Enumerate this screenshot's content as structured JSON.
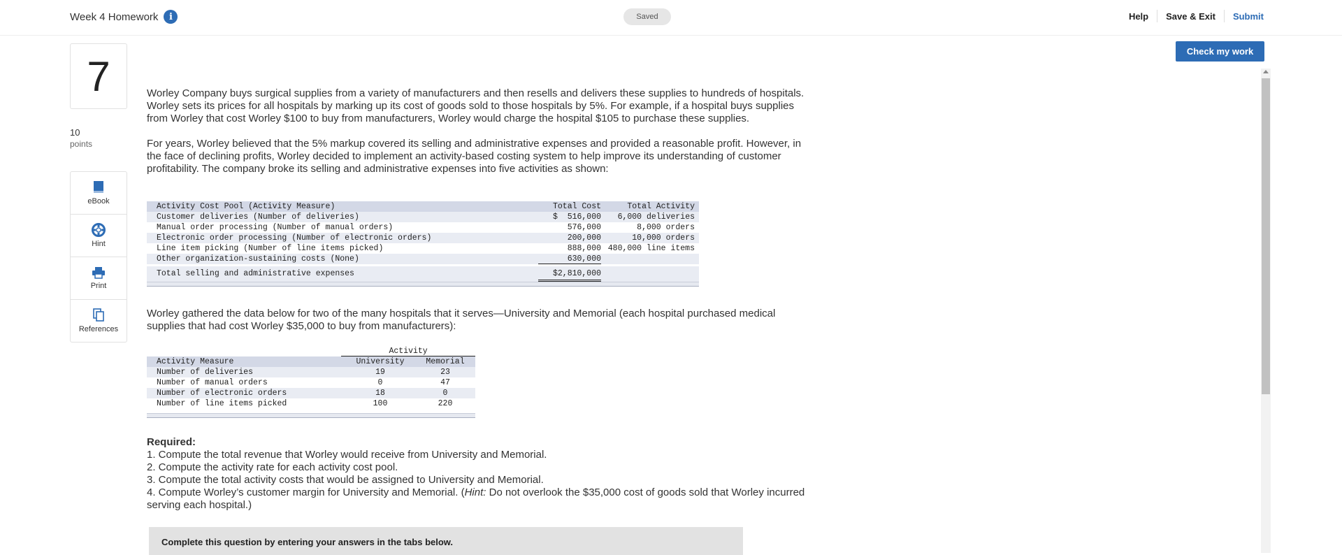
{
  "header": {
    "title": "Week 4 Homework",
    "status": "Saved",
    "help": "Help",
    "save_exit": "Save & Exit",
    "submit": "Submit"
  },
  "check_my_work": "Check my work",
  "question": {
    "number": "7",
    "points_value": "10",
    "points_label": "points"
  },
  "tools": [
    {
      "label": "eBook",
      "icon": "book-icon"
    },
    {
      "label": "Hint",
      "icon": "lifebuoy-icon"
    },
    {
      "label": "Print",
      "icon": "printer-icon"
    },
    {
      "label": "References",
      "icon": "copy-icon"
    }
  ],
  "paragraphs": {
    "p1": "Worley Company buys surgical supplies from a variety of manufacturers and then resells and delivers these supplies to hundreds of hospitals. Worley sets its prices for all hospitals by marking up its cost of goods sold to those hospitals by 5%. For example, if a hospital buys supplies from Worley that cost Worley $100 to buy from manufacturers, Worley would charge the hospital $105 to purchase these supplies.",
    "p2": "For years, Worley believed that the 5% markup covered its selling and administrative expenses and provided a reasonable profit. However, in the face of declining profits, Worley decided to implement an activity-based costing system to help improve its understanding of customer profitability. The company broke its selling and administrative expenses into five activities as shown:",
    "p3": "Worley gathered the data below for two of the many hospitals that it serves—University and Memorial (each hospital purchased medical supplies that had cost Worley $35,000 to buy from manufacturers):"
  },
  "cost_table": {
    "headers": [
      "Activity Cost Pool (Activity Measure)",
      "Total Cost",
      "Total Activity"
    ],
    "rows": [
      [
        "Customer deliveries (Number of deliveries)",
        "$  516,000",
        "6,000 deliveries"
      ],
      [
        "Manual order processing (Number of manual orders)",
        "576,000",
        "8,000 orders"
      ],
      [
        "Electronic order processing (Number of electronic orders)",
        "200,000",
        "10,000 orders"
      ],
      [
        "Line item picking (Number of line items picked)",
        "888,000",
        "480,000 line items"
      ],
      [
        "Other organization-sustaining costs (None)",
        "630,000",
        ""
      ]
    ],
    "total": [
      "Total selling and administrative expenses",
      "$2,810,000"
    ]
  },
  "activity_table": {
    "group_header": "Activity",
    "headers": [
      "Activity Measure",
      "University",
      "Memorial"
    ],
    "rows": [
      [
        "Number of deliveries",
        "19",
        "23"
      ],
      [
        "Number of manual orders",
        "0",
        "47"
      ],
      [
        "Number of electronic orders",
        "18",
        "0"
      ],
      [
        "Number of line items picked",
        "100",
        "220"
      ]
    ]
  },
  "required": {
    "title": "Required:",
    "items": [
      "1. Compute the total revenue that Worley would receive from University and Memorial.",
      "2. Compute the activity rate for each activity cost pool.",
      "3. Compute the total activity costs that would be assigned to University and Memorial."
    ],
    "item4_a": "4. Compute Worley’s customer margin for University and Memorial. (",
    "item4_hint": "Hint:",
    "item4_b": " Do not overlook the $35,000 cost of goods sold that Worley incurred serving each hospital.)"
  },
  "tabs_instruction": "Complete this question by entering your answers in the tabs below."
}
